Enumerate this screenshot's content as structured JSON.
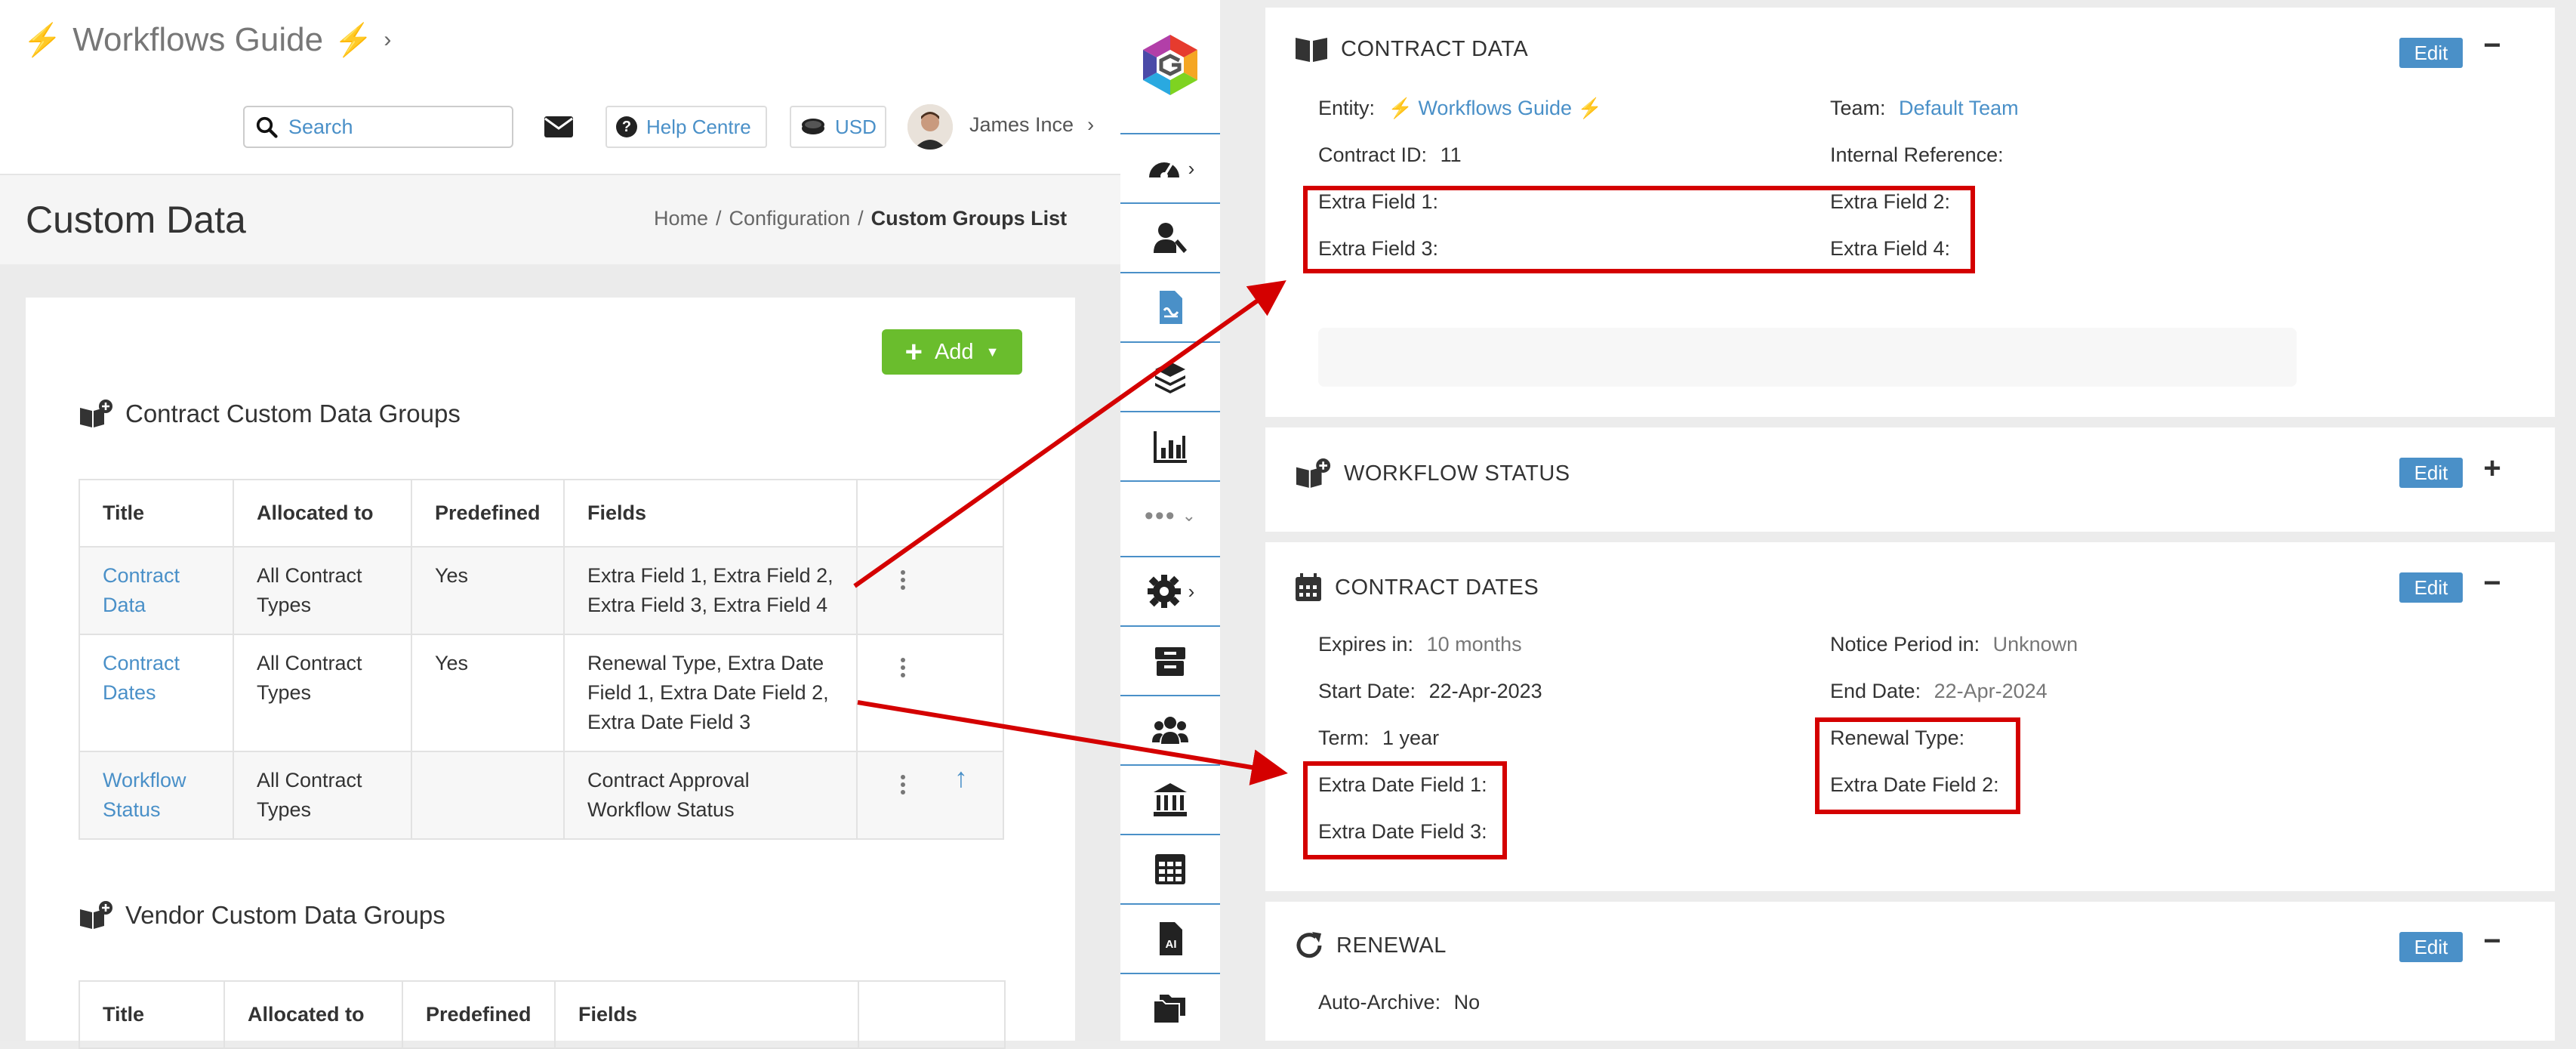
{
  "header": {
    "org_name": "Workflows Guide",
    "search_placeholder": "Search",
    "help_label": "Help Centre",
    "currency_label": "USD",
    "user_name": "James Ince"
  },
  "page": {
    "title": "Custom Data",
    "breadcrumb": [
      "Home",
      "Configuration",
      "Custom Groups List"
    ],
    "add_label": "Add"
  },
  "contract_groups": {
    "title": "Contract Custom Data Groups",
    "columns": [
      "Title",
      "Allocated to",
      "Predefined",
      "Fields"
    ],
    "rows": [
      {
        "title": "Contract Data",
        "allocated": "All Contract Types",
        "predefined": "Yes",
        "fields": "Extra Field 1, Extra Field 2, Extra Field 3, Extra Field 4"
      },
      {
        "title": "Contract Dates",
        "allocated": "All Contract Types",
        "predefined": "Yes",
        "fields": "Renewal Type, Extra Date Field 1, Extra Date Field 2, Extra Date Field 3"
      },
      {
        "title": "Workflow Status",
        "allocated": "All Contract Types",
        "predefined": "",
        "fields": "Contract Approval Workflow Status"
      }
    ]
  },
  "vendor_groups": {
    "title": "Vendor Custom Data Groups",
    "columns": [
      "Title",
      "Allocated to",
      "Predefined",
      "Fields"
    ]
  },
  "panels": {
    "contract_data": {
      "title": "CONTRACT DATA",
      "edit": "Edit",
      "entity_label": "Entity:",
      "entity_value": "Workflows Guide",
      "team_label": "Team:",
      "team_value": "Default Team",
      "contract_id_label": "Contract ID:",
      "contract_id_value": "11",
      "internal_ref_label": "Internal Reference:",
      "extra_field_1": "Extra Field 1:",
      "extra_field_2": "Extra Field 2:",
      "extra_field_3": "Extra Field 3:",
      "extra_field_4": "Extra Field 4:"
    },
    "workflow_status": {
      "title": "WORKFLOW STATUS",
      "edit": "Edit"
    },
    "contract_dates": {
      "title": "CONTRACT DATES",
      "edit": "Edit",
      "expires_label": "Expires in:",
      "expires_value": "10 months",
      "notice_label": "Notice Period in:",
      "notice_value": "Unknown",
      "start_label": "Start Date:",
      "start_value": "22-Apr-2023",
      "end_label": "End Date:",
      "end_value": "22-Apr-2024",
      "term_label": "Term:",
      "term_value": "1 year",
      "renewal_type_label": "Renewal Type:",
      "extra_date_1": "Extra Date Field 1:",
      "extra_date_2": "Extra Date Field 2:",
      "extra_date_3": "Extra Date Field 3:"
    },
    "renewal": {
      "title": "RENEWAL",
      "edit": "Edit",
      "auto_archive_label": "Auto-Archive:",
      "auto_archive_value": "No"
    }
  },
  "icons": {
    "sidebar": [
      "dashboard-icon",
      "user-settings-icon",
      "contract-document-icon",
      "layers-icon",
      "reports-chart-icon",
      "more-icon",
      "settings-gear-icon",
      "archive-icon",
      "users-group-icon",
      "bank-icon",
      "table-icon",
      "ai-document-icon",
      "folders-icon"
    ]
  },
  "colors": {
    "accent": "#4a90c8",
    "add_button": "#6abd2d",
    "highlight": "#d40000",
    "bolt": "#f0b400"
  }
}
